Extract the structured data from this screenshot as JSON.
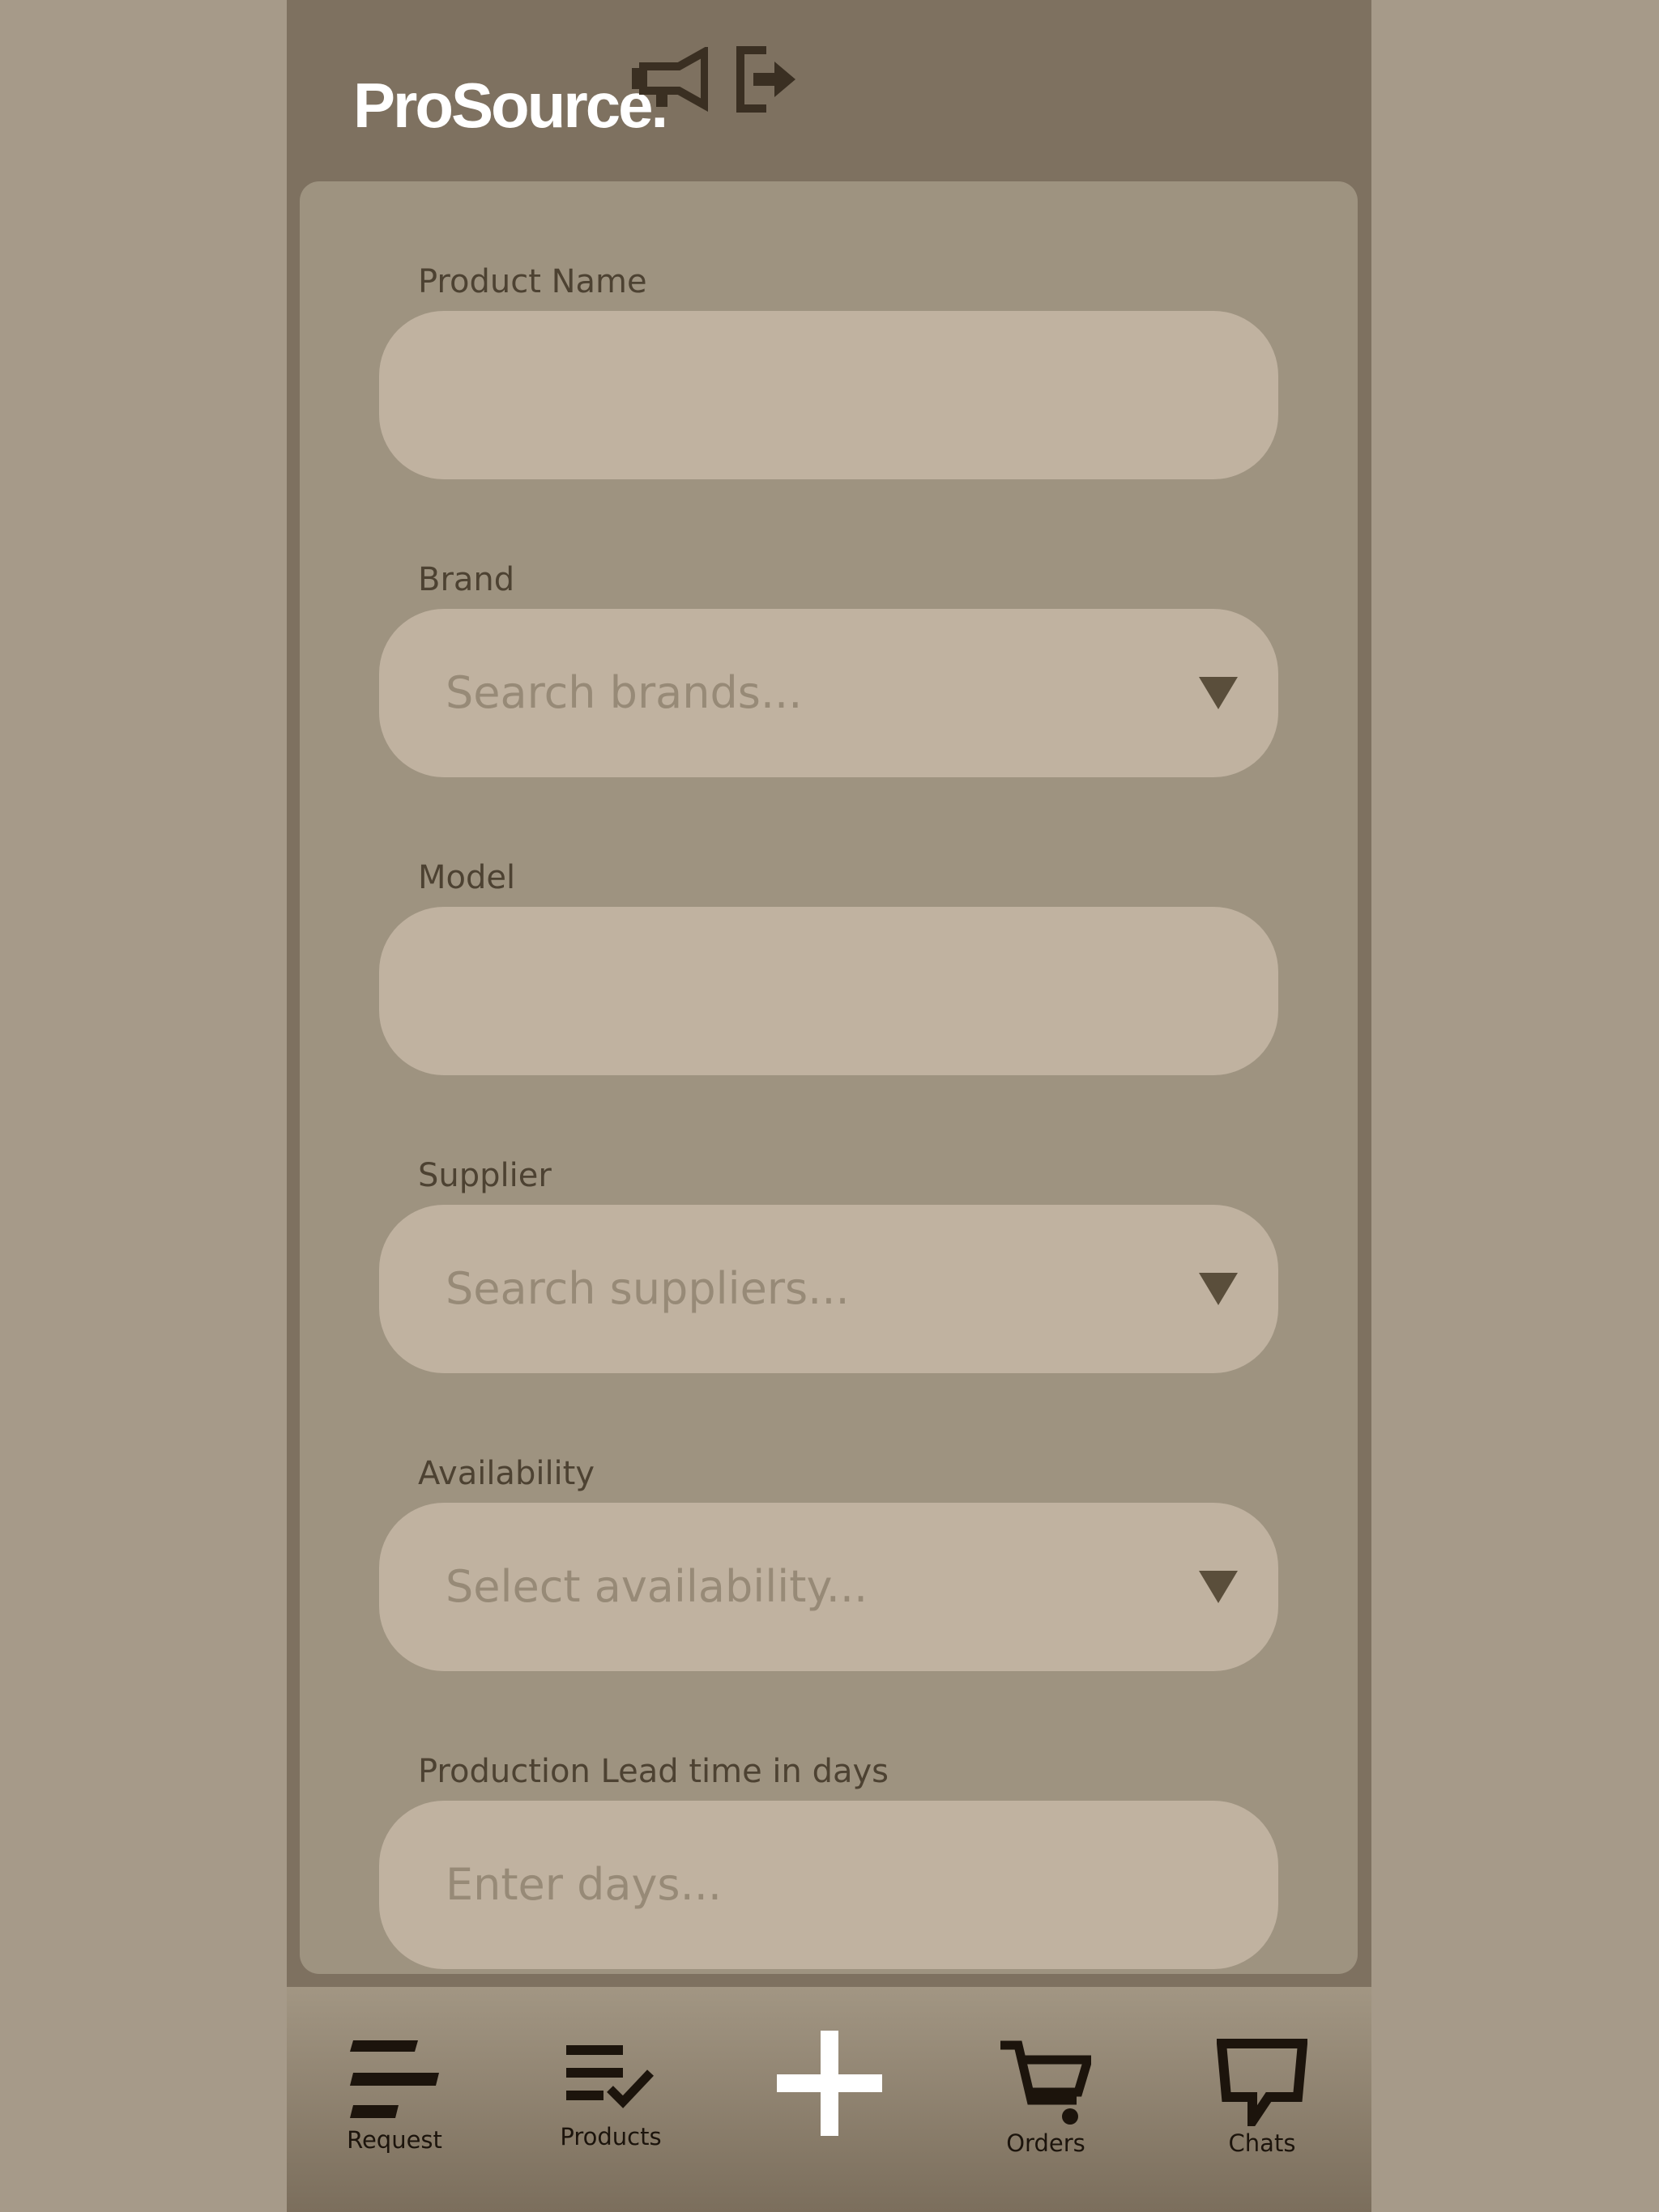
{
  "header": {
    "logo_text": "ProSource.",
    "icons": [
      "megaphone-icon",
      "logout-icon"
    ]
  },
  "form": {
    "fields": [
      {
        "label": "Product Name",
        "placeholder": "",
        "type": "text"
      },
      {
        "label": "Brand",
        "placeholder": "Search brands...",
        "type": "dropdown"
      },
      {
        "label": "Model",
        "placeholder": "",
        "type": "text"
      },
      {
        "label": "Supplier",
        "placeholder": "Search suppliers...",
        "type": "dropdown"
      },
      {
        "label": "Availability",
        "placeholder": "Select availability...",
        "type": "dropdown"
      },
      {
        "label": "Production Lead time in days",
        "placeholder": "Enter days...",
        "type": "number"
      }
    ]
  },
  "nav": {
    "items": [
      {
        "label": "Request",
        "icon": "request-list-icon"
      },
      {
        "label": "Products",
        "icon": "products-checklist-icon"
      },
      {
        "label": "",
        "icon": "plus-icon"
      },
      {
        "label": "Orders",
        "icon": "cart-icon"
      },
      {
        "label": "Chats",
        "icon": "chat-icon"
      }
    ]
  },
  "colors": {
    "backdrop": "#a69a89",
    "app_bg": "#7e7160",
    "card_bg": "#9e9380",
    "field_bg": "#c0b2a0",
    "label_text": "#4d4232",
    "placeholder_text": "#978a77",
    "icon_dark": "#1c140c",
    "logo": "#ffffff"
  }
}
